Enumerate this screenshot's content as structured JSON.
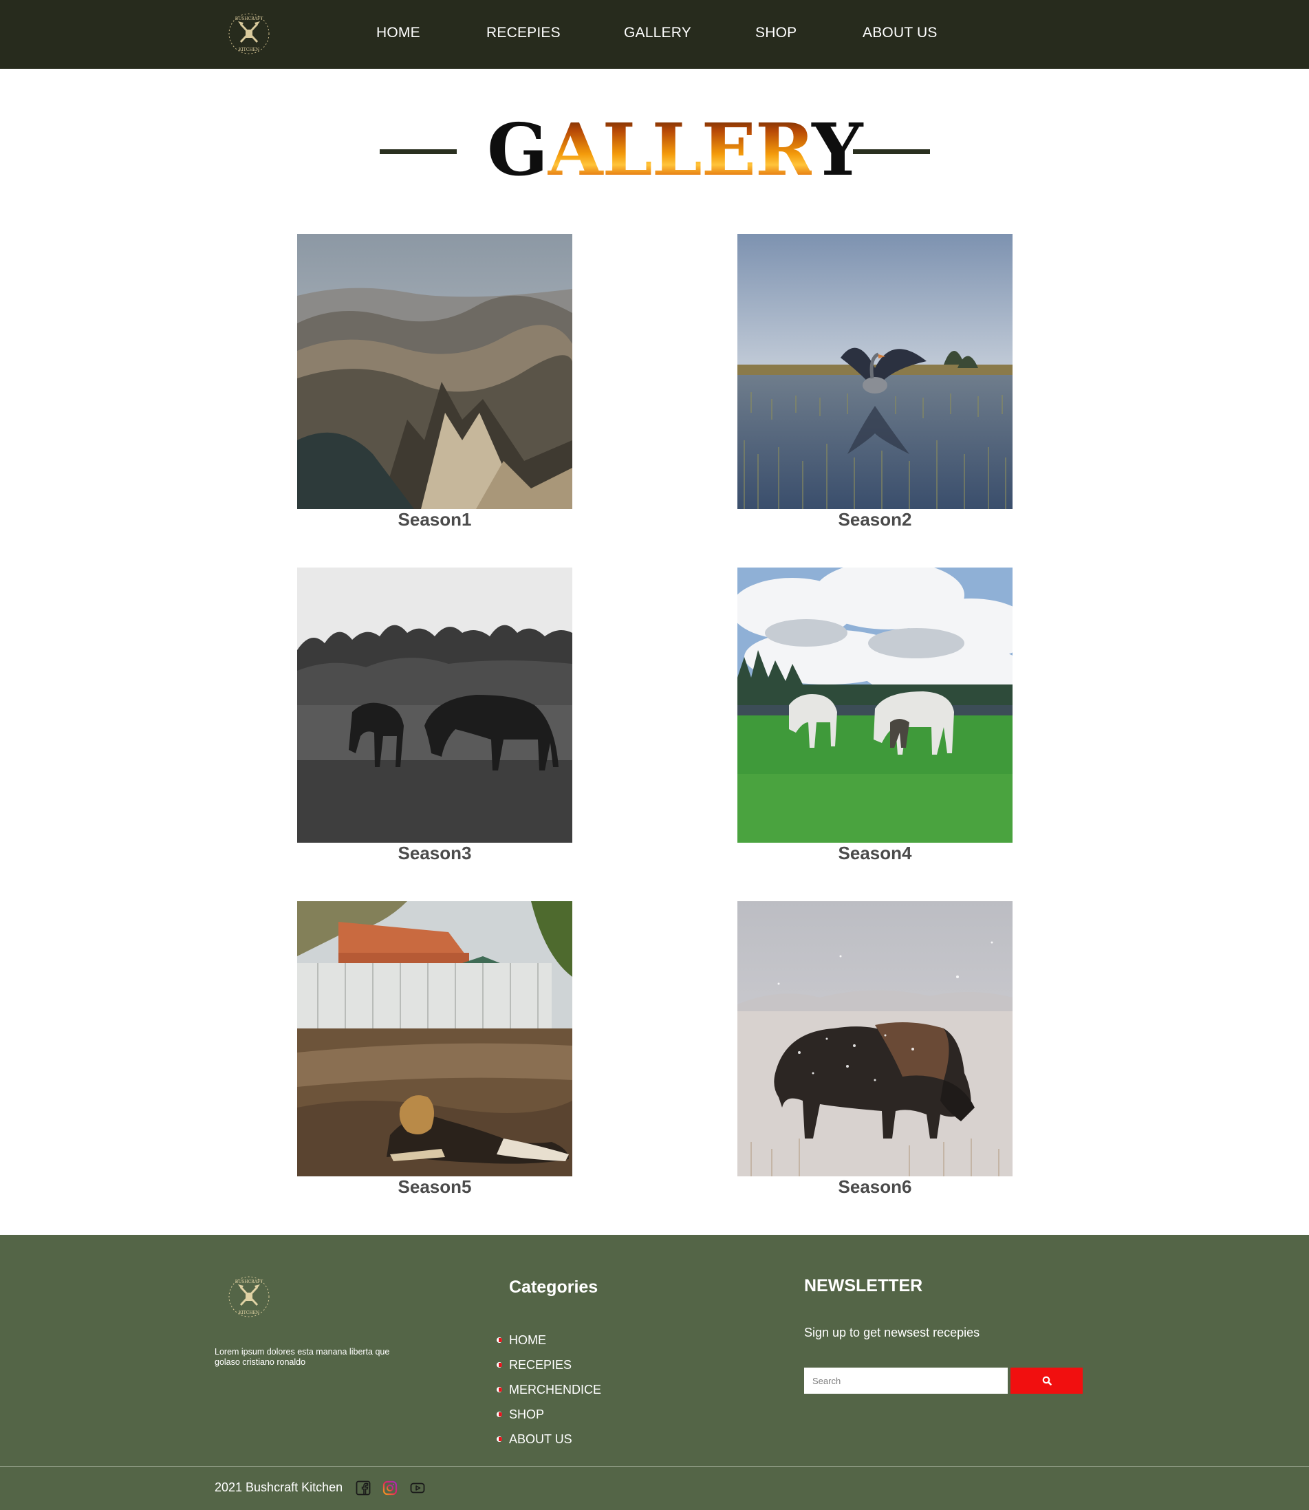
{
  "header": {
    "logo_alt": "Bushcraft Kitchen",
    "nav": [
      {
        "label": "HOME"
      },
      {
        "label": "RECEPIES"
      },
      {
        "label": "GALLERY"
      },
      {
        "label": "SHOP"
      },
      {
        "label": "ABOUT US"
      }
    ]
  },
  "page_title": {
    "part1": "G",
    "part2": "ALLER",
    "part3": "Y"
  },
  "gallery": [
    {
      "caption": "Season1",
      "subject": "mountain range"
    },
    {
      "caption": "Season2",
      "subject": "goose spreading wings on water"
    },
    {
      "caption": "Season3",
      "subject": "two horses grazing black and white"
    },
    {
      "caption": "Season4",
      "subject": "two white horses in green field"
    },
    {
      "caption": "Season5",
      "subject": "dog lying in yard"
    },
    {
      "caption": "Season6",
      "subject": "bison in snow"
    }
  ],
  "footer": {
    "about_text": "Lorem ipsum dolores esta manana liberta que golaso cristiano ronaldo",
    "categories_heading": "Categories",
    "categories": [
      {
        "label": "HOME"
      },
      {
        "label": "RECEPIES"
      },
      {
        "label": "MERCHENDICE"
      },
      {
        "label": "SHOP"
      },
      {
        "label": "ABOUT US"
      }
    ],
    "newsletter_heading": "NEWSLETTER",
    "newsletter_text": "Sign up to get newsest recepies",
    "search_placeholder": "Search",
    "search_icon": "search-icon",
    "copyright": "2021 Bushcraft Kitchen",
    "social": [
      "facebook-icon",
      "instagram-icon",
      "youtube-icon"
    ]
  },
  "colors": {
    "header_bg": "#272b1d",
    "footer_bg": "#546547",
    "accent_red": "#f10f0f",
    "caption_text": "#4b4b4b"
  }
}
